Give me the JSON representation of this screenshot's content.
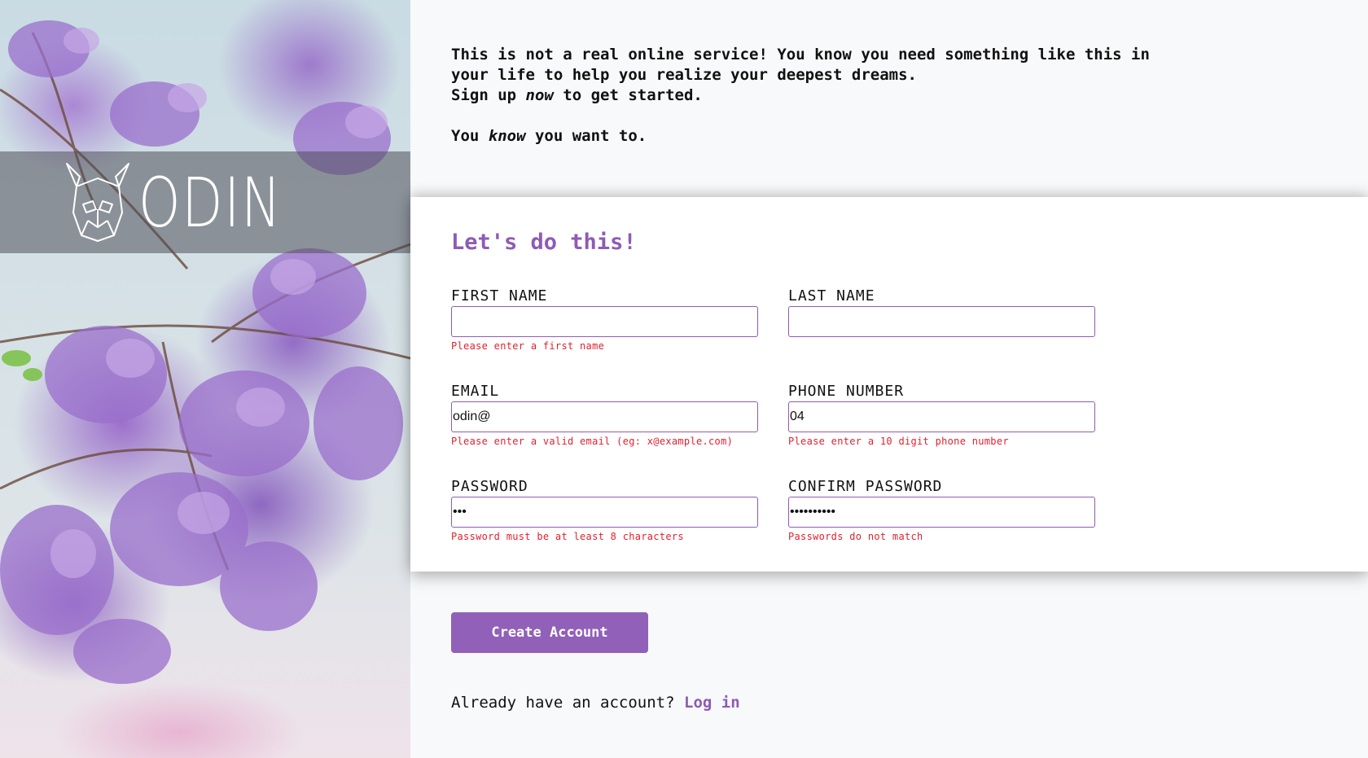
{
  "brand": {
    "name": "ODIN",
    "icon": "viking-helmet-icon"
  },
  "intro": {
    "line1": "This is not a real online service! You know you need something like this in",
    "line2": "your life to help you realize your deepest dreams.",
    "line3_before": "Sign up ",
    "line3_em": "now",
    "line3_after": " to get started.",
    "line4_before": "You ",
    "line4_em": "know",
    "line4_after": " you want to."
  },
  "form": {
    "title": "Let's do this!",
    "first_name": {
      "label": "FIRST NAME",
      "value": "",
      "error": "Please enter a first name"
    },
    "last_name": {
      "label": "LAST NAME",
      "value": "",
      "error": ""
    },
    "email": {
      "label": "EMAIL",
      "value": "odin@",
      "error": "Please enter a valid email (eg: x@example.com)"
    },
    "phone": {
      "label": "PHONE NUMBER",
      "value": "04",
      "error": "Please enter a 10 digit phone number"
    },
    "password": {
      "label": "PASSWORD",
      "value": "abc",
      "error": "Password must be at least 8 characters"
    },
    "confirm_password": {
      "label": "CONFIRM PASSWORD",
      "value": "abcdefghij",
      "error": "Passwords do not match"
    }
  },
  "actions": {
    "create_account": "Create Account",
    "login_prompt": "Already have an account?",
    "login_link": "Log in"
  },
  "colors": {
    "accent": "#8e5bb5",
    "button": "#9160b8",
    "error": "#e2212f",
    "background": "#f8f9fa"
  }
}
